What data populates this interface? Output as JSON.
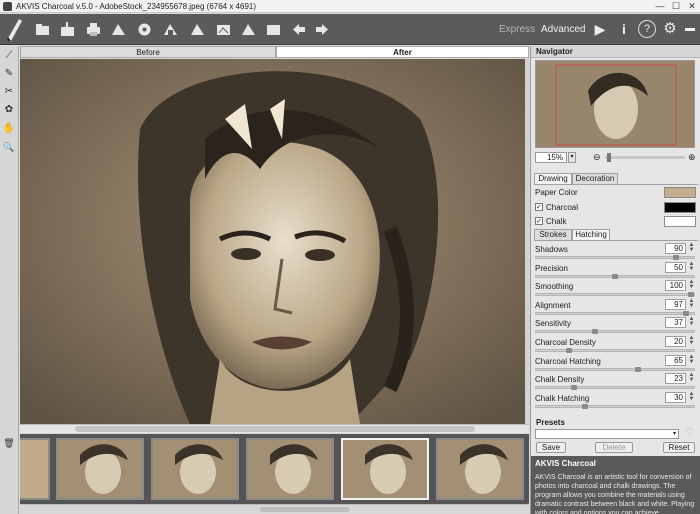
{
  "window": {
    "title": "AKVIS Charcoal v.5.0 - AdobeStock_234955678.jpeg (6764 x 4691)",
    "minimize": "—",
    "maximize": "☐",
    "close": "✕"
  },
  "toolbar": {
    "icons": [
      "open-icon",
      "save-icon",
      "print-icon",
      "share-icon",
      "export-icon",
      "batch-icon",
      "plugin-icon",
      "settings-icon",
      "brush-icon",
      "preset-icon",
      "import-icon",
      "export-preset-icon",
      "undo-icon",
      "redo-icon"
    ],
    "express_label": "Express",
    "advanced_label": "Advanced",
    "run": "▶",
    "info": "i",
    "help": "?",
    "prefs": "⚙",
    "chat": "▬"
  },
  "view_tabs": {
    "before": "Before",
    "after": "After"
  },
  "left_tools": [
    "⟋",
    "✎",
    "✂",
    "✿",
    "✋",
    "🔍"
  ],
  "left_trash": "🗑",
  "colors": {
    "toolbar": "#5b5b5b",
    "paper": "#c4ad8c",
    "charcoal": "#000000",
    "chalk": "#ffffff",
    "accent_tab": "#ffffff"
  },
  "navigator": {
    "title": "Navigator",
    "zoom": "15%",
    "zoom_out": "⊖",
    "zoom_in": "⊕"
  },
  "drawing_tabs": {
    "drawing": "Drawing",
    "decoration": "Decoration"
  },
  "drawing": {
    "paper_color_label": "Paper Color",
    "charcoal_label": "Charcoal",
    "chalk_label": "Chalk",
    "charcoal_checked": "✓",
    "chalk_checked": "✓"
  },
  "sub_tabs": {
    "strokes": "Strokes",
    "hatching": "Hatching"
  },
  "params": [
    {
      "label": "Shadows",
      "value": "90",
      "level": 0.9
    },
    {
      "label": "Precision",
      "value": "50",
      "level": 0.5
    },
    {
      "label": "Smoothing",
      "value": "100",
      "level": 1.0
    },
    {
      "label": "Alignment",
      "value": "97",
      "level": 0.97
    },
    {
      "label": "Sensitivity",
      "value": "37",
      "level": 0.37
    },
    {
      "label": "Charcoal Density",
      "value": "20",
      "level": 0.2
    },
    {
      "label": "Charcoal Hatching",
      "value": "65",
      "level": 0.65
    },
    {
      "label": "Chalk Density",
      "value": "23",
      "level": 0.23
    },
    {
      "label": "Chalk Hatching",
      "value": "30",
      "level": 0.3
    }
  ],
  "presets": {
    "title": "Presets",
    "save": "Save",
    "delete": "Delete",
    "reset": "Reset",
    "heart": "♡"
  },
  "description": {
    "title": "AKVIS Charcoal",
    "text": "AKVIS Charcoal is an artistic tool for conversion of photos into charcoal and chalk drawings. The program allows you combine the materials using dramatic contrast between black and white. Playing with colors and options you can achieve"
  }
}
